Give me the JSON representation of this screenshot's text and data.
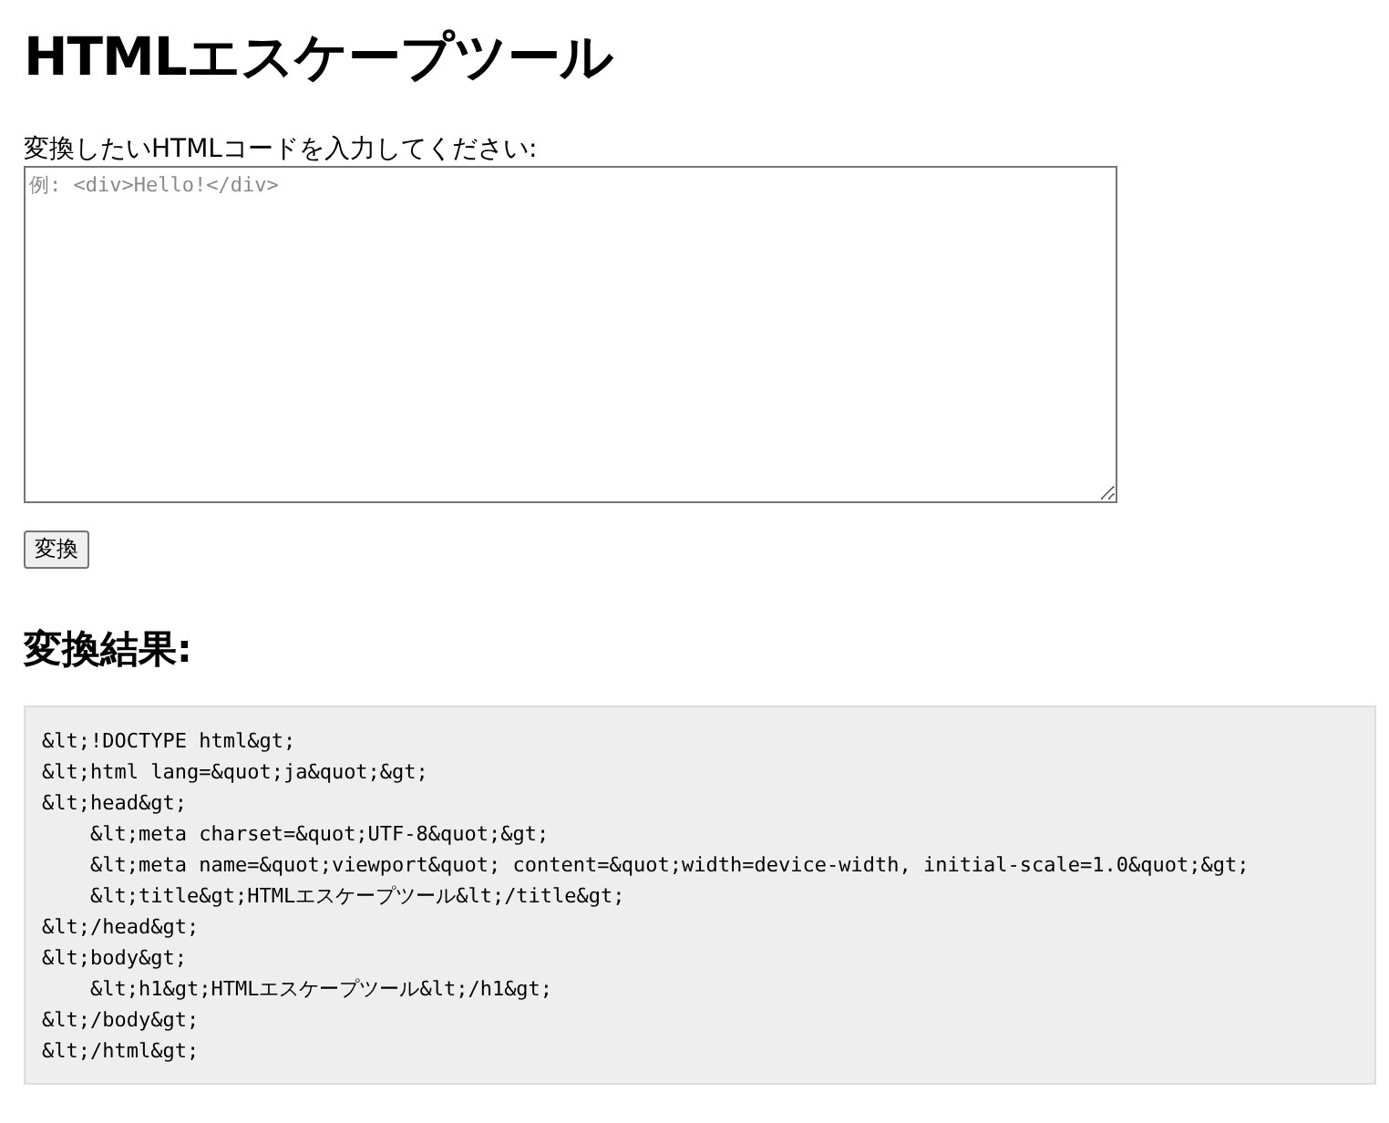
{
  "title": "HTMLエスケープツール",
  "input": {
    "label": "変換したいHTMLコードを入力してください:",
    "placeholder": "例: <div>Hello!</div>"
  },
  "button": "変換",
  "result": {
    "heading": "変換結果:",
    "output": "&lt;!DOCTYPE html&gt;\n&lt;html lang=&quot;ja&quot;&gt;\n&lt;head&gt;\n    &lt;meta charset=&quot;UTF-8&quot;&gt;\n    &lt;meta name=&quot;viewport&quot; content=&quot;width=device-width, initial-scale=1.0&quot;&gt;\n    &lt;title&gt;HTMLエスケープツール&lt;/title&gt;\n&lt;/head&gt;\n&lt;body&gt;\n    &lt;h1&gt;HTMLエスケープツール&lt;/h1&gt;\n&lt;/body&gt;\n&lt;/html&gt;"
  }
}
